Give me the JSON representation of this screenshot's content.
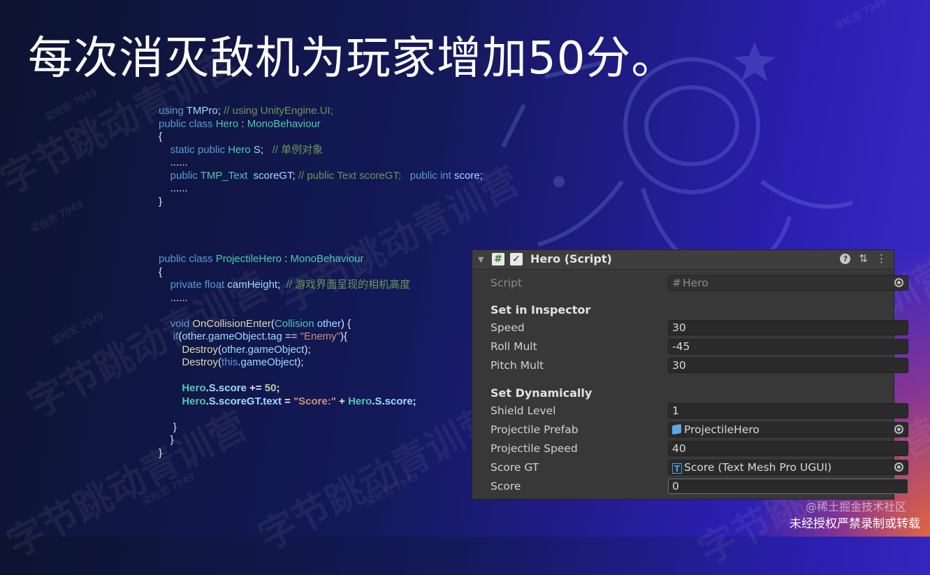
{
  "slide": {
    "title": "每次消灭敌机为玩家增加50分。",
    "watermark_big": "字节跳动青训营",
    "watermark_small": "梁皎宏 7949"
  },
  "code_block_1": {
    "lines": [
      [
        {
          "t": "using ",
          "c": "kw"
        },
        {
          "t": "TMPro",
          "c": "id"
        },
        {
          "t": "; ",
          "c": ""
        },
        {
          "t": "// using UnityEngine.UI;",
          "c": "cm"
        }
      ],
      [
        {
          "t": "public class ",
          "c": "kw"
        },
        {
          "t": "Hero",
          "c": "ty"
        },
        {
          "t": " : ",
          "c": ""
        },
        {
          "t": "MonoBehaviour",
          "c": "ty"
        }
      ],
      [
        {
          "t": "{",
          "c": ""
        }
      ],
      [
        {
          "t": "    static public ",
          "c": "kw"
        },
        {
          "t": "Hero",
          "c": "ty"
        },
        {
          "t": " ",
          "c": ""
        },
        {
          "t": "S",
          "c": "id"
        },
        {
          "t": ";   ",
          "c": ""
        },
        {
          "t": "// 单例对象",
          "c": "cm"
        }
      ],
      [
        {
          "t": "    ......",
          "c": ""
        }
      ],
      [
        {
          "t": "    public ",
          "c": "kw"
        },
        {
          "t": "TMP_Text",
          "c": "ty"
        },
        {
          "t": "  ",
          "c": ""
        },
        {
          "t": "scoreGT",
          "c": "id"
        },
        {
          "t": "; ",
          "c": ""
        },
        {
          "t": "// public Text scoreGT;   ",
          "c": "cm"
        },
        {
          "t": "public int ",
          "c": "kw"
        },
        {
          "t": "score",
          "c": "id"
        },
        {
          "t": ";",
          "c": ""
        }
      ],
      [
        {
          "t": "    ......",
          "c": ""
        }
      ],
      [
        {
          "t": "}",
          "c": ""
        }
      ]
    ]
  },
  "code_block_2": {
    "lines": [
      [
        {
          "t": "public class ",
          "c": "kw"
        },
        {
          "t": "ProjectileHero",
          "c": "ty"
        },
        {
          "t": " : ",
          "c": ""
        },
        {
          "t": "MonoBehaviour",
          "c": "ty"
        }
      ],
      [
        {
          "t": "{",
          "c": ""
        }
      ],
      [
        {
          "t": "    private float ",
          "c": "kw"
        },
        {
          "t": "camHeight",
          "c": "id"
        },
        {
          "t": ";  ",
          "c": ""
        },
        {
          "t": "// 游戏界面呈现的相机高度",
          "c": "cm"
        }
      ],
      [
        {
          "t": "    ......",
          "c": ""
        }
      ],
      [
        {
          "t": "",
          "c": ""
        }
      ],
      [
        {
          "t": "    void ",
          "c": "kw"
        },
        {
          "t": "OnCollisionEnter",
          "c": "fn"
        },
        {
          "t": "(",
          "c": ""
        },
        {
          "t": "Collision",
          "c": "ty"
        },
        {
          "t": " ",
          "c": ""
        },
        {
          "t": "other",
          "c": "id"
        },
        {
          "t": ") {",
          "c": ""
        }
      ],
      [
        {
          "t": "     if",
          "c": "kw"
        },
        {
          "t": "(",
          "c": ""
        },
        {
          "t": "other",
          "c": "id"
        },
        {
          "t": ".",
          "c": ""
        },
        {
          "t": "gameObject",
          "c": "id"
        },
        {
          "t": ".",
          "c": ""
        },
        {
          "t": "tag",
          "c": "id"
        },
        {
          "t": " == ",
          "c": ""
        },
        {
          "t": "\"Enemy\"",
          "c": "st"
        },
        {
          "t": "){",
          "c": ""
        }
      ],
      [
        {
          "t": "        ",
          "c": ""
        },
        {
          "t": "Destroy",
          "c": "fn"
        },
        {
          "t": "(",
          "c": ""
        },
        {
          "t": "other",
          "c": "id"
        },
        {
          "t": ".",
          "c": ""
        },
        {
          "t": "gameObject",
          "c": "id"
        },
        {
          "t": ");",
          "c": ""
        }
      ],
      [
        {
          "t": "        ",
          "c": ""
        },
        {
          "t": "Destroy",
          "c": "fn"
        },
        {
          "t": "(",
          "c": ""
        },
        {
          "t": "this",
          "c": "kw"
        },
        {
          "t": ".",
          "c": ""
        },
        {
          "t": "gameObject",
          "c": "id"
        },
        {
          "t": ");",
          "c": ""
        }
      ],
      [
        {
          "t": "",
          "c": ""
        }
      ],
      [
        {
          "t": "        ",
          "c": ""
        },
        {
          "t": "Hero",
          "c": "ty bold"
        },
        {
          "t": ".",
          "c": "bold"
        },
        {
          "t": "S",
          "c": "id bold"
        },
        {
          "t": ".",
          "c": "bold"
        },
        {
          "t": "score",
          "c": "id bold"
        },
        {
          "t": " += ",
          "c": "bold"
        },
        {
          "t": "50",
          "c": "nm bold"
        },
        {
          "t": ";",
          "c": "bold"
        }
      ],
      [
        {
          "t": "        ",
          "c": ""
        },
        {
          "t": "Hero",
          "c": "ty bold"
        },
        {
          "t": ".",
          "c": "bold"
        },
        {
          "t": "S",
          "c": "id bold"
        },
        {
          "t": ".",
          "c": "bold"
        },
        {
          "t": "scoreGT",
          "c": "id bold"
        },
        {
          "t": ".",
          "c": "bold"
        },
        {
          "t": "text",
          "c": "id bold"
        },
        {
          "t": " = ",
          "c": "bold"
        },
        {
          "t": "\"Score:\"",
          "c": "st bold"
        },
        {
          "t": " + ",
          "c": "bold"
        },
        {
          "t": "Hero",
          "c": "ty bold"
        },
        {
          "t": ".",
          "c": "bold"
        },
        {
          "t": "S",
          "c": "id bold"
        },
        {
          "t": ".",
          "c": "bold"
        },
        {
          "t": "score",
          "c": "id bold"
        },
        {
          "t": ";",
          "c": "bold"
        }
      ],
      [
        {
          "t": "",
          "c": ""
        }
      ],
      [
        {
          "t": "     }",
          "c": ""
        }
      ],
      [
        {
          "t": "    }",
          "c": ""
        }
      ],
      [
        {
          "t": "}",
          "c": ""
        }
      ]
    ]
  },
  "inspector": {
    "component_title": "Hero (Script)",
    "script_label": "Script",
    "script_value": "Hero",
    "section_inspector": "Set in Inspector",
    "speed_label": "Speed",
    "speed_value": "30",
    "roll_label": "Roll Mult",
    "roll_value": "-45",
    "pitch_label": "Pitch Mult",
    "pitch_value": "30",
    "section_dynamic": "Set Dynamically",
    "shield_label": "Shield Level",
    "shield_value": "1",
    "prefab_label": "Projectile Prefab",
    "prefab_value": "ProjectileHero",
    "proj_speed_label": "Projectile Speed",
    "proj_speed_value": "40",
    "score_gt_label": "Score GT",
    "score_gt_value": "Score (Text Mesh Pro UGUI)",
    "score_label": "Score",
    "score_value": "0"
  },
  "footer": {
    "credit": "@稀土掘金技术社区",
    "notice": "未经授权严禁录制或转载"
  }
}
